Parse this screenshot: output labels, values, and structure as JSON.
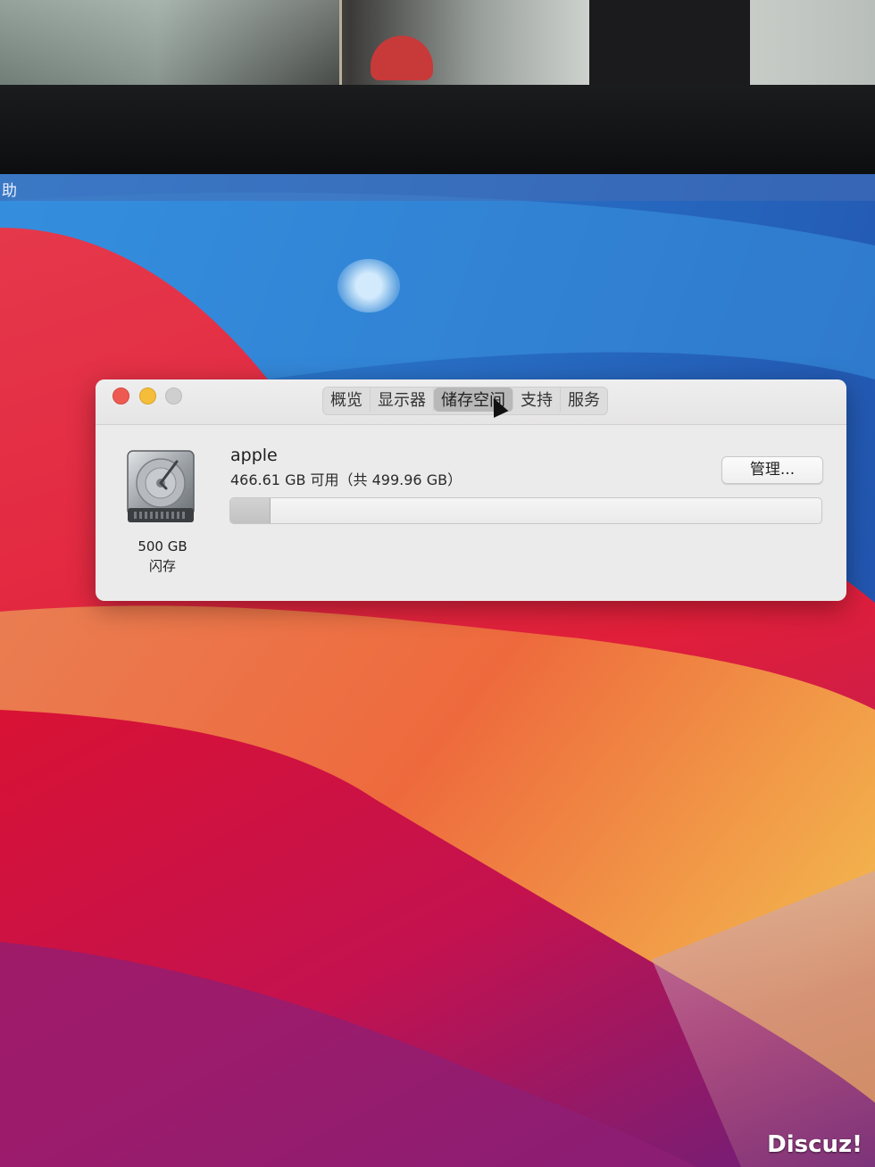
{
  "menubar": {
    "partial_item": "助"
  },
  "window": {
    "tabs": [
      {
        "label": "概览",
        "active": false
      },
      {
        "label": "显示器",
        "active": false
      },
      {
        "label": "储存空间",
        "active": true
      },
      {
        "label": "支持",
        "active": false
      },
      {
        "label": "服务",
        "active": false
      }
    ],
    "drive": {
      "icon": "hard-drive-icon",
      "capacity": "500 GB",
      "type": "闪存"
    },
    "volume": {
      "name": "apple",
      "free_text": "466.61 GB 可用（共 499.96 GB）",
      "used_fraction": 0.067
    },
    "manage_label": "管理..."
  },
  "watermark": "Discuz!",
  "colors": {
    "close": "#ee5a52",
    "minimize": "#f5bd3a",
    "zoom_disabled": "#d0cfcf"
  }
}
